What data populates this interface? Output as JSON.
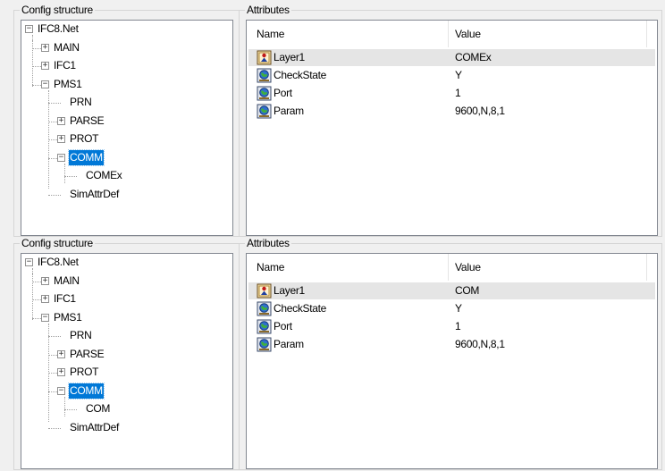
{
  "colors": {
    "selection": "#0078d7",
    "highlight_row": "#e5e5e5",
    "border": "#828790"
  },
  "panels": [
    {
      "tree_group_title": "Config structure",
      "attr_group_title": "Attributes",
      "tree": [
        {
          "label": "IFC8.Net",
          "expander": "−",
          "selected": false
        },
        {
          "label": "MAIN",
          "expander": "+",
          "selected": false
        },
        {
          "label": "IFC1",
          "expander": "+",
          "selected": false
        },
        {
          "label": "PMS1",
          "expander": "−",
          "selected": false
        },
        {
          "label": "PRN",
          "expander": "",
          "selected": false
        },
        {
          "label": "PARSE",
          "expander": "+",
          "selected": false
        },
        {
          "label": "PROT",
          "expander": "+",
          "selected": false
        },
        {
          "label": "COMM",
          "expander": "−",
          "selected": true
        },
        {
          "label": "COMEx",
          "expander": "",
          "selected": false
        },
        {
          "label": "SimAttrDef",
          "expander": "",
          "selected": false
        }
      ],
      "columns": {
        "name": "Name",
        "value": "Value"
      },
      "rows": [
        {
          "name": "Layer1",
          "value": "COMEx",
          "icon": "layer-person-icon"
        },
        {
          "name": "CheckState",
          "value": "Y",
          "icon": "globe-icon"
        },
        {
          "name": "Port",
          "value": "1",
          "icon": "globe-icon"
        },
        {
          "name": "Param",
          "value": "9600,N,8,1",
          "icon": "globe-icon"
        }
      ]
    },
    {
      "tree_group_title": "Config structure",
      "attr_group_title": "Attributes",
      "tree": [
        {
          "label": "IFC8.Net",
          "expander": "−",
          "selected": false
        },
        {
          "label": "MAIN",
          "expander": "+",
          "selected": false
        },
        {
          "label": "IFC1",
          "expander": "+",
          "selected": false
        },
        {
          "label": "PMS1",
          "expander": "−",
          "selected": false
        },
        {
          "label": "PRN",
          "expander": "",
          "selected": false
        },
        {
          "label": "PARSE",
          "expander": "+",
          "selected": false
        },
        {
          "label": "PROT",
          "expander": "+",
          "selected": false
        },
        {
          "label": "COMM",
          "expander": "−",
          "selected": true
        },
        {
          "label": "COM",
          "expander": "",
          "selected": false
        },
        {
          "label": "SimAttrDef",
          "expander": "",
          "selected": false
        }
      ],
      "columns": {
        "name": "Name",
        "value": "Value"
      },
      "rows": [
        {
          "name": "Layer1",
          "value": "COM",
          "icon": "layer-person-icon"
        },
        {
          "name": "CheckState",
          "value": "Y",
          "icon": "globe-icon"
        },
        {
          "name": "Port",
          "value": "1",
          "icon": "globe-icon"
        },
        {
          "name": "Param",
          "value": "9600,N,8,1",
          "icon": "globe-icon"
        }
      ]
    }
  ]
}
